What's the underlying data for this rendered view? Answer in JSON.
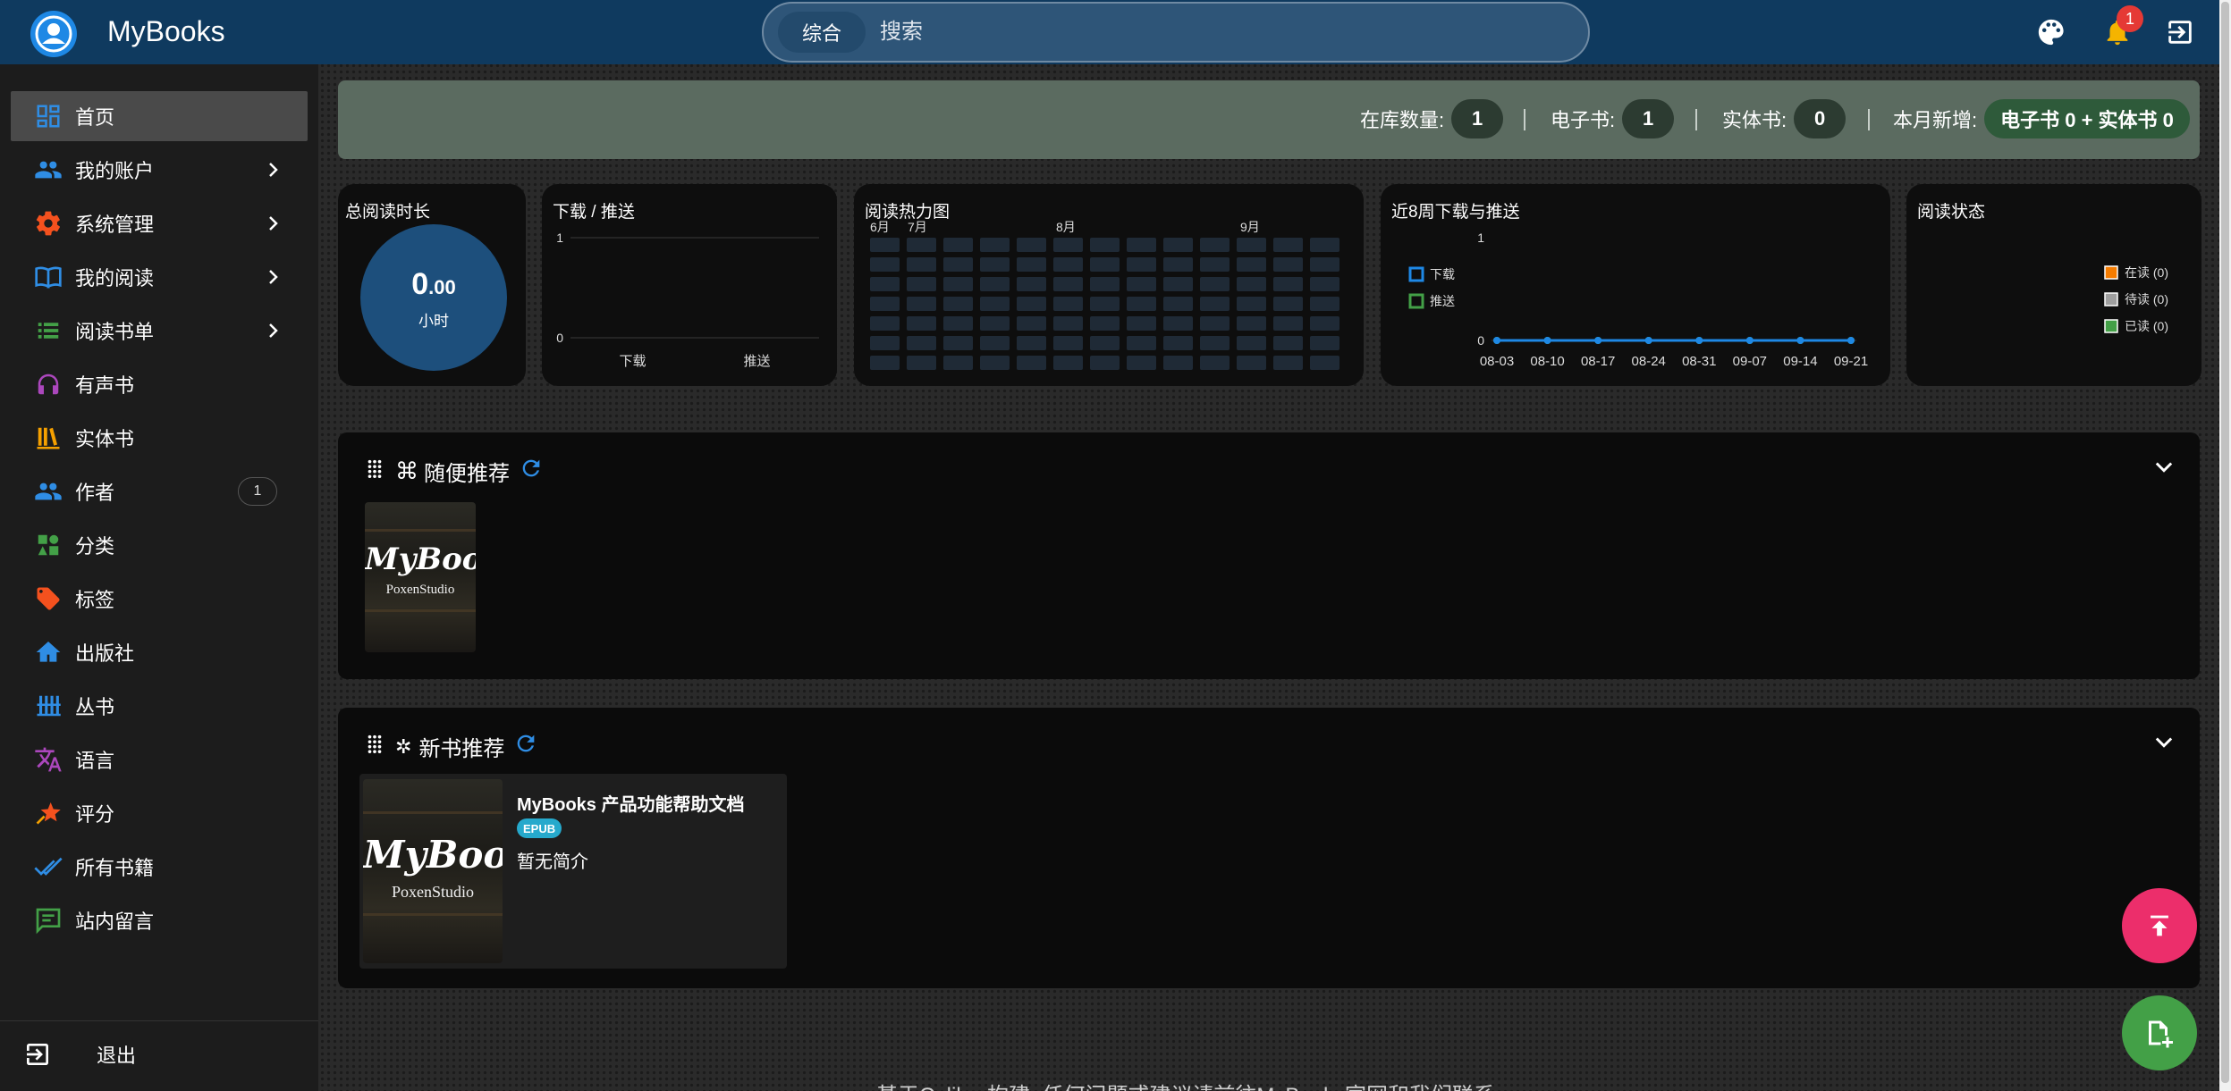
{
  "app": {
    "title": "MyBooks"
  },
  "search": {
    "scope": "综合",
    "placeholder": "搜索"
  },
  "header": {
    "notification_count": "1"
  },
  "sidebar": {
    "items": [
      {
        "label": "首页"
      },
      {
        "label": "我的账户"
      },
      {
        "label": "系统管理"
      },
      {
        "label": "我的阅读"
      },
      {
        "label": "阅读书单"
      },
      {
        "label": "有声书"
      },
      {
        "label": "实体书"
      },
      {
        "label": "作者",
        "count": "1"
      },
      {
        "label": "分类"
      },
      {
        "label": "标签"
      },
      {
        "label": "出版社"
      },
      {
        "label": "丛书"
      },
      {
        "label": "语言"
      },
      {
        "label": "评分"
      },
      {
        "label": "所有书籍"
      },
      {
        "label": "站内留言"
      }
    ],
    "logout": "退出"
  },
  "stats": {
    "in_stock_label": "在库数量:",
    "in_stock_value": "1",
    "ebook_label": "电子书:",
    "ebook_value": "1",
    "physical_label": "实体书:",
    "physical_value": "0",
    "monthly_label": "本月新增:",
    "monthly_value": "电子书 0 + 实体书 0"
  },
  "cards": {
    "reading_time": {
      "title": "总阅读时长",
      "value_int": "0",
      "value_dec": ".00",
      "unit": "小时"
    },
    "download_push": {
      "title": "下载 / 推送"
    },
    "heatmap": {
      "title": "阅读热力图",
      "months": [
        "6月",
        "7月",
        "8月",
        "9月"
      ]
    },
    "weekly": {
      "title": "近8周下载与推送"
    },
    "reading_status": {
      "title": "阅读状态"
    }
  },
  "chart_data": [
    {
      "type": "bar",
      "title": "下载 / 推送",
      "categories": [
        "下载",
        "推送"
      ],
      "values": [
        0,
        0
      ],
      "ylim": [
        0,
        1
      ],
      "yticks": [
        "1",
        "0"
      ]
    },
    {
      "type": "line",
      "title": "近8周下载与推送",
      "x": [
        "08-03",
        "08-10",
        "08-17",
        "08-24",
        "08-31",
        "09-07",
        "09-14",
        "09-21"
      ],
      "series": [
        {
          "name": "下载",
          "values": [
            0,
            0,
            0,
            0,
            0,
            0,
            0,
            0
          ],
          "color": "#1e88e5"
        },
        {
          "name": "推送",
          "values": [
            0,
            0,
            0,
            0,
            0,
            0,
            0,
            0
          ],
          "color": "#43a047"
        }
      ],
      "ylim": [
        0,
        1
      ],
      "yticks": [
        "1",
        "0"
      ],
      "legend": "left"
    },
    {
      "type": "pie",
      "title": "阅读状态",
      "categories": [
        "在读 (0)",
        "待读 (0)",
        "已读 (0)"
      ],
      "values": [
        0,
        0,
        0
      ],
      "colors": [
        "#f57c00",
        "#9e9e9e",
        "#43a047"
      ],
      "legend": "right"
    }
  ],
  "panels": {
    "random": {
      "title": "随便推荐"
    },
    "new_books": {
      "title": "新书推荐"
    }
  },
  "book": {
    "title": "MyBooks 产品功能帮助文档",
    "format": "EPUB",
    "summary": "暂无简介",
    "cover_title": "MyBooks",
    "cover_sub": "PoxenStudio"
  },
  "footer": {
    "text": "基于Calibre构建, 任何问题或建议请前往MyBooks官网和我们联系"
  },
  "colors": {
    "topbar": "#0f3a5f",
    "accent": "#1e88e5",
    "fab_upload": "#ec2e6b",
    "fab_add": "#43a047"
  }
}
